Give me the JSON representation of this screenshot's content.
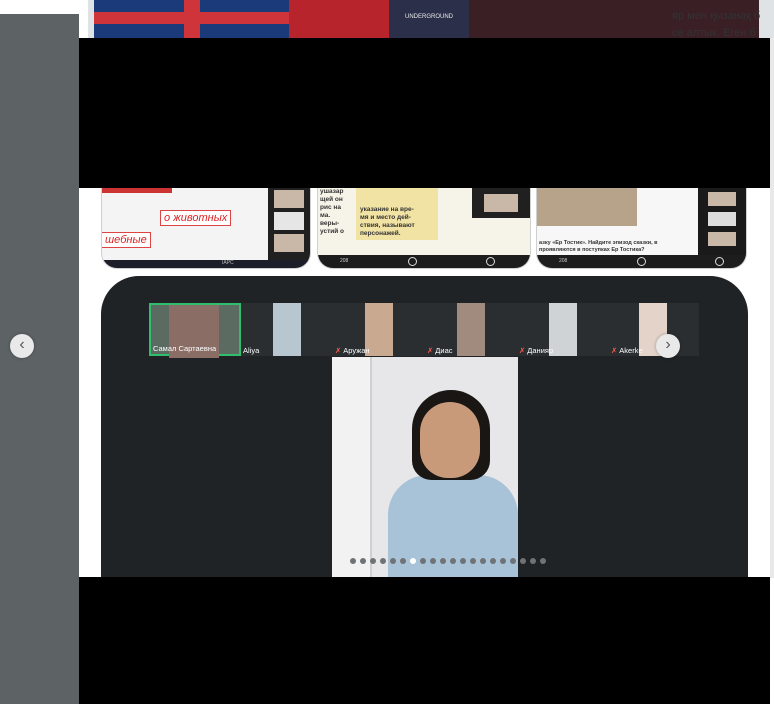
{
  "background_page": {
    "header_image_labels": {
      "underground_sign": "UNDERGROUND"
    },
    "article_text": {
      "line1": "яр мен қызанақ б",
      "line2": "се алтык. Еген б"
    }
  },
  "gallery": {
    "thumbnails": [
      {
        "name": "slide-russian-flowchart",
        "flow_labels": [
          "о животных",
          "шебные"
        ],
        "taskbar_text": "IAPC"
      },
      {
        "name": "slide-book-page",
        "left_text": [
          "ушазар",
          "щей он",
          "рис на",
          "ма.",
          "веры-",
          "устий о"
        ],
        "note_text": [
          "указание на вре-",
          "мя и место дей-",
          "ствия, называют",
          "персонажей."
        ],
        "bottom_label": "208"
      },
      {
        "name": "slide-er-tostik",
        "caption": "азку «Ер Тостик». Найдите эпизод сказки, в проявляются в поступках Ер Тостика?",
        "bottom_label": "208"
      }
    ],
    "main_view": {
      "participants": [
        {
          "name": "Самал Сартаевна",
          "muted": false,
          "active": true
        },
        {
          "name": "Aliya",
          "muted": false,
          "active": false
        },
        {
          "name": "Аружан",
          "muted": true,
          "active": false
        },
        {
          "name": "Диас",
          "muted": true,
          "active": false
        },
        {
          "name": "Данияр",
          "muted": true,
          "active": false
        },
        {
          "name": "Akerke",
          "muted": true,
          "active": false
        }
      ],
      "page_dots": {
        "total": 20,
        "active_index": 6
      }
    },
    "nav": {
      "prev_symbol": "‹",
      "next_symbol": "›"
    }
  },
  "colors": {
    "speaker_border": "#2fbf6c",
    "muted_mic": "#ff5a4a",
    "card_bg": "#1f2326"
  }
}
